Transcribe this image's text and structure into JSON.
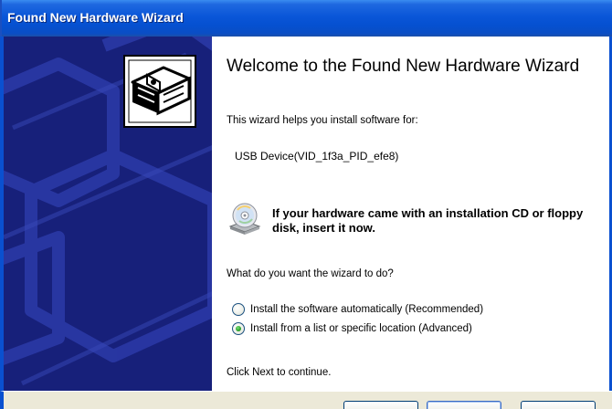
{
  "window": {
    "title": "Found New Hardware Wizard"
  },
  "icons": {
    "wizard_hardware": "hardware-device-icon",
    "cd": "cd-drive-icon"
  },
  "colors": {
    "title_bar": "#0a56d8",
    "left_panel": "#17207a",
    "radio_check": "#2aa12a"
  },
  "content": {
    "welcome_title": "Welcome to the Found New Hardware Wizard",
    "helps_text": "This wizard helps you install software for:",
    "device_name": "USB Device(VID_1f3a_PID_efe8)",
    "cd_prompt": "If your hardware came with an installation CD or floppy disk, insert it now.",
    "question": "What do you want the wizard to do?",
    "options": [
      {
        "label": "Install the software automatically (Recommended)",
        "selected": false
      },
      {
        "label": "Install from a list or specific location (Advanced)",
        "selected": true
      }
    ],
    "continue_text": "Click Next to continue."
  }
}
